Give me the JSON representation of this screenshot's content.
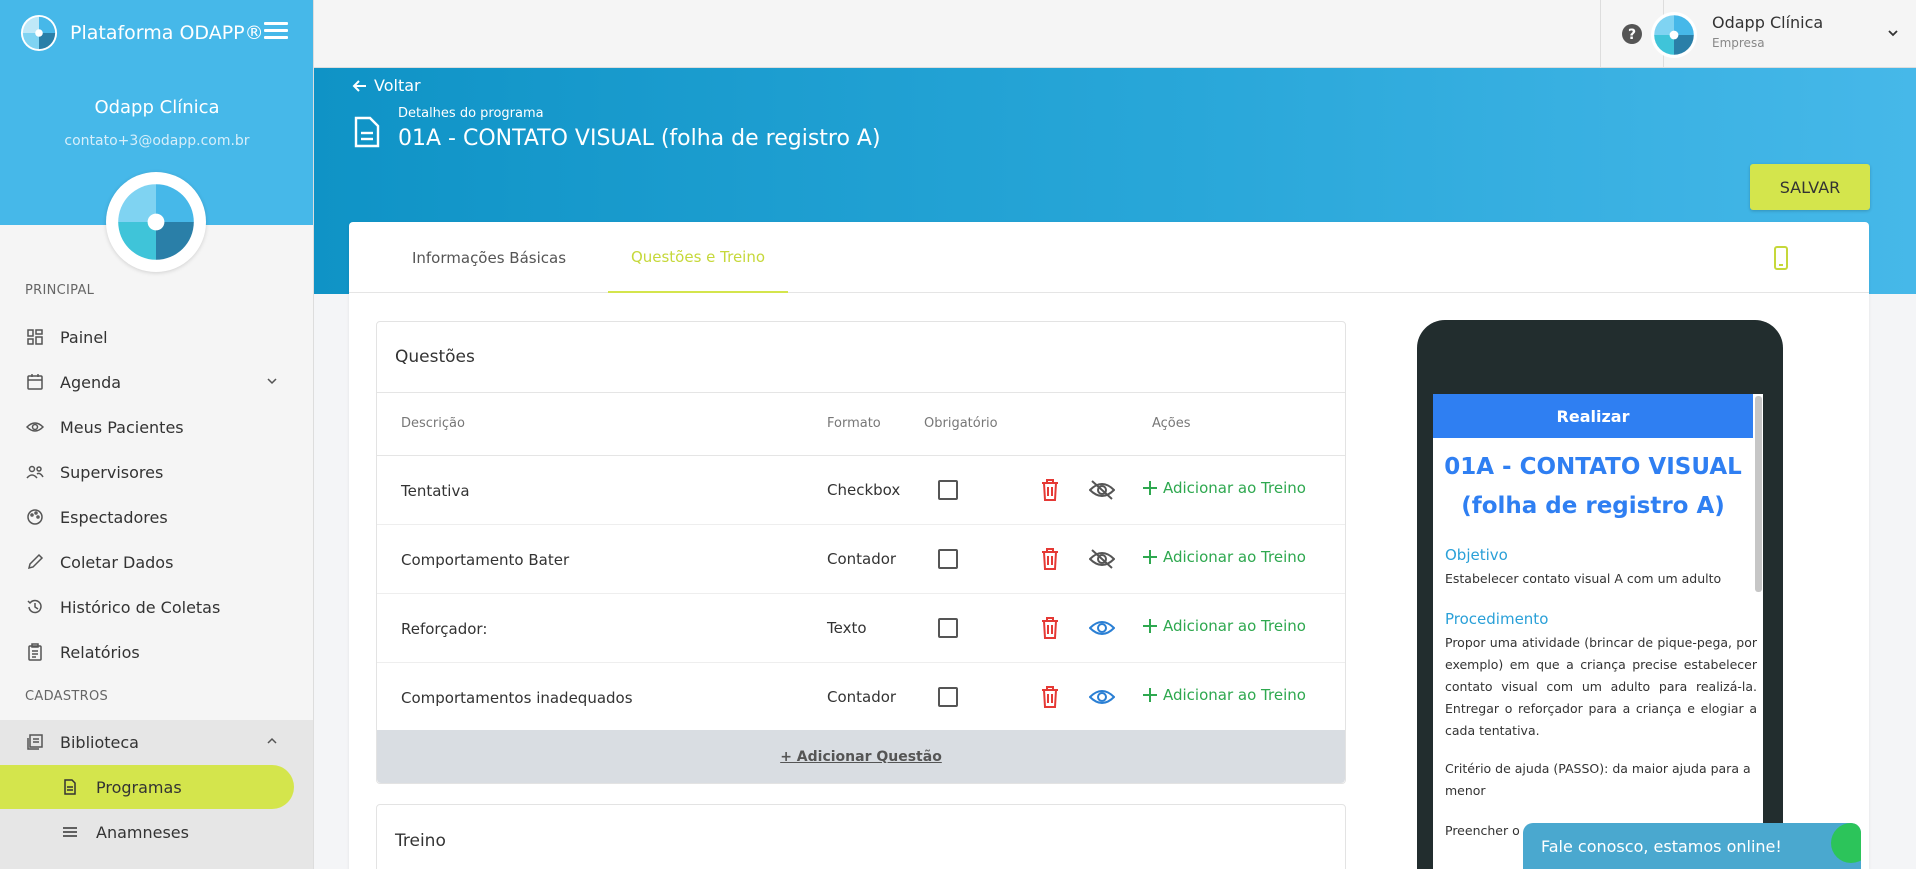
{
  "sidebar": {
    "brand": "Plataforma ODAPP®",
    "user_name": "Odapp Clínica",
    "user_email": "contato+3@odapp.com.br",
    "section_main": "PRINCIPAL",
    "section_cadastros": "CADASTROS",
    "items": [
      {
        "label": "Painel",
        "icon": "dashboard-icon"
      },
      {
        "label": "Agenda",
        "icon": "calendar-icon"
      },
      {
        "label": "Meus Pacientes",
        "icon": "eye-icon"
      },
      {
        "label": "Supervisores",
        "icon": "users-icon"
      },
      {
        "label": "Espectadores",
        "icon": "palette-icon"
      },
      {
        "label": "Coletar Dados",
        "icon": "pencil-icon"
      },
      {
        "label": "Histórico de Coletas",
        "icon": "history-icon"
      },
      {
        "label": "Relatórios",
        "icon": "clipboard-icon"
      }
    ],
    "library": {
      "label": "Biblioteca",
      "icon": "book-icon"
    },
    "sub_items": [
      {
        "label": "Programas",
        "icon": "document-icon",
        "active": true
      },
      {
        "label": "Anamneses",
        "icon": "list-icon",
        "active": false
      }
    ]
  },
  "topbar": {
    "user_name": "Odapp Clínica",
    "user_role": "Empresa"
  },
  "header": {
    "back_label": "Voltar",
    "subtitle": "Detalhes do programa",
    "title": "01A - CONTATO VISUAL (folha de registro A)",
    "save_label": "SALVAR"
  },
  "tabs": [
    {
      "label": "Informações Básicas",
      "active": false
    },
    {
      "label": "Questões e Treino",
      "active": true
    }
  ],
  "questions": {
    "title": "Questões",
    "columns": {
      "description": "Descrição",
      "format": "Formato",
      "required": "Obrigatório",
      "actions": "Ações"
    },
    "rows": [
      {
        "description": "Tentativa",
        "format": "Checkbox",
        "visible": false,
        "add_label": "Adicionar ao Treino"
      },
      {
        "description": "Comportamento Bater",
        "format": "Contador",
        "visible": false,
        "add_label": "Adicionar ao Treino"
      },
      {
        "description": "Reforçador:",
        "format": "Texto",
        "visible": true,
        "add_label": "Adicionar ao Treino"
      },
      {
        "description": "Comportamentos inadequados",
        "format": "Contador",
        "visible": true,
        "add_label": "Adicionar ao Treino"
      }
    ],
    "add_question_label": "+ Adicionar Questão"
  },
  "training": {
    "title": "Treino"
  },
  "preview": {
    "bar_label": "Realizar",
    "title": "01A - CONTATO VISUAL (folha de registro A)",
    "objective_heading": "Objetivo",
    "objective_text": "Estabelecer contato visual A com um adulto",
    "procedure_heading": "Procedimento",
    "procedure_text": "Propor uma atividade (brincar de pique-pega, por exemplo) em que a criança precise estabelecer contato visual com um adulto para realizá-la. Entregar o reforçador para a criança e elogiar a cada tentativa.",
    "help_criteria": "Critério de ajuda (PASSO): da maior ajuda para a menor",
    "fill_text": "Preencher o"
  },
  "chat": {
    "label": "Fale conosco, estamos online!"
  },
  "colors": {
    "primary": "#46b8e9",
    "accent": "#d4e54c",
    "success": "#2ea84f",
    "danger": "#e53935",
    "info": "#2f7ff2"
  }
}
